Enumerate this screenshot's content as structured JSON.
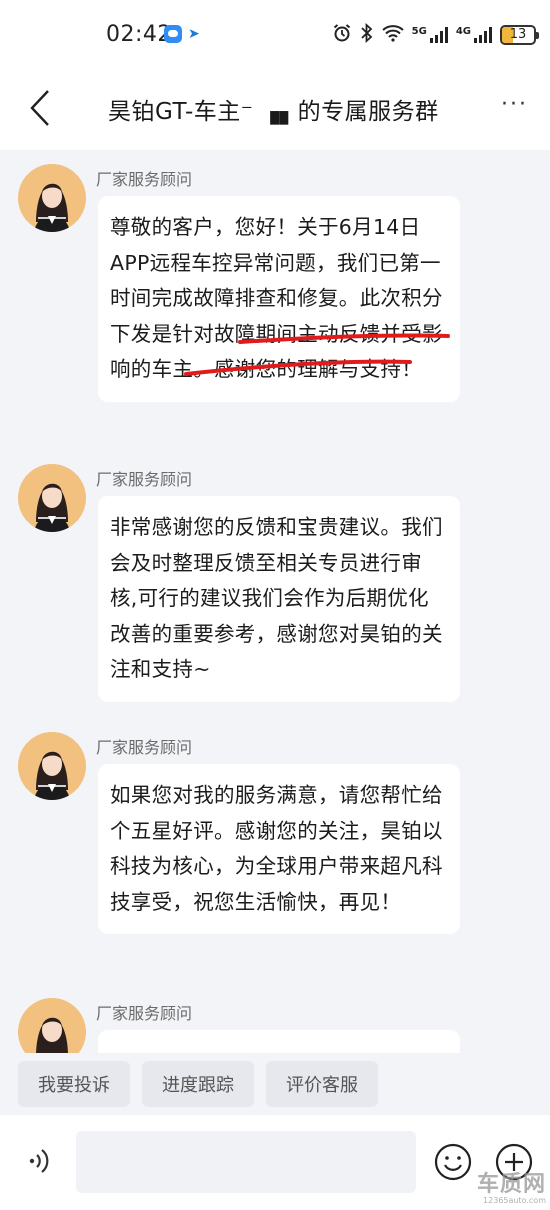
{
  "status_bar": {
    "time": "02:42",
    "network_a": "5G",
    "network_b": "4G",
    "battery": "13",
    "accent_color": "#f0b73a"
  },
  "header": {
    "title": "昊铂GT-车主⁻  ▗▖的专属服务群",
    "more": "···",
    "back_icon": "chevron-left-icon"
  },
  "messages": [
    {
      "sender": "厂家服务顾问",
      "text": "尊敬的客户，您好！关于6月14日APP远程车控异常问题，我们已第一时间完成故障排查和修复。此次积分下发是针对故障期间主动反馈并受影响的车主。感谢您的理解与支持！"
    },
    {
      "sender": "厂家服务顾问",
      "text": "非常感谢您的反馈和宝贵建议。我们会及时整理反馈至相关专员进行审核,可行的建议我们会作为后期优化改善的重要参考，感谢您对昊铂的关注和支持~"
    },
    {
      "sender": "厂家服务顾问",
      "text": "如果您对我的服务满意，请您帮忙给个五星好评。感谢您的关注，昊铂以科技为核心，为全球用户带来超凡科技享受，祝您生活愉快，再见！"
    },
    {
      "sender": "厂家服务顾问",
      "text": ""
    }
  ],
  "quick_actions": [
    "我要投诉",
    "进度跟踪",
    "评价客服"
  ],
  "input": {
    "placeholder": "",
    "value": ""
  },
  "watermark": {
    "main": "车质网",
    "sub": "12365auto.com"
  },
  "colors": {
    "underline": "#e01b1b",
    "background": "#f3f4f8"
  }
}
